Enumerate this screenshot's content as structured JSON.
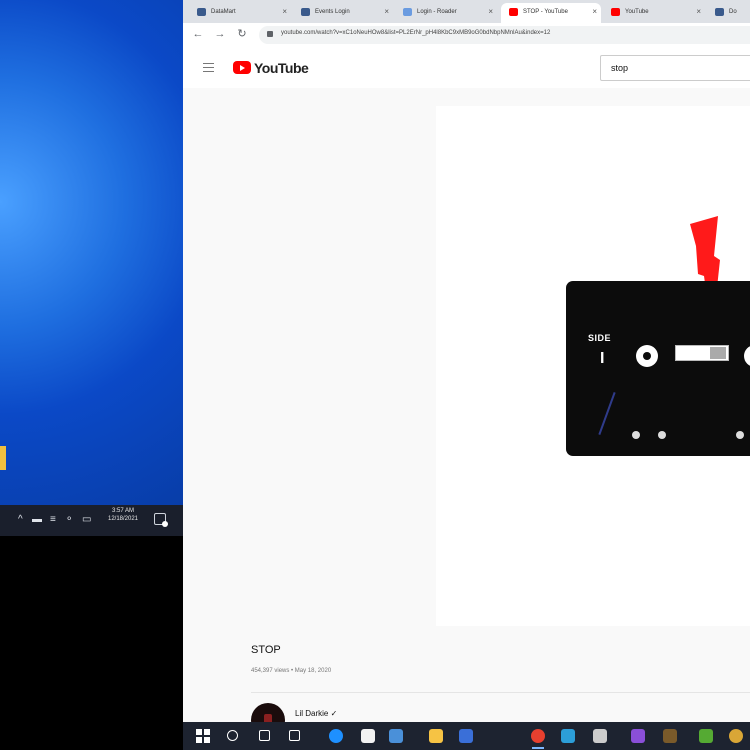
{
  "desktop": {
    "tray": {
      "glyphs": [
        "^",
        "▬",
        "≡",
        "⚬",
        "▭"
      ],
      "time": "3:57 AM",
      "date": "12/18/2021"
    }
  },
  "browser": {
    "tabs": [
      {
        "label": "DataMart",
        "icon": "doc-icon",
        "active": false
      },
      {
        "label": "Events Login",
        "icon": "doc-icon",
        "active": false
      },
      {
        "label": "Login - Roader",
        "icon": "chart-icon",
        "active": false
      },
      {
        "label": "STOP - YouTube",
        "icon": "youtube-icon",
        "active": true
      },
      {
        "label": "YouTube",
        "icon": "youtube-icon",
        "active": false
      },
      {
        "label": "Do",
        "icon": "doc-icon",
        "active": false
      }
    ],
    "nav": {
      "back": "←",
      "forward": "→",
      "reload": "↻"
    },
    "url": "youtube.com/watch?v=xC1oNeuHOw8&list=PL2ErNr_pH4l8KbC9xMB9oG0bdNbpNMnlAu&index=12"
  },
  "youtube": {
    "logo_text": "YouTube",
    "search_value": "stop",
    "video": {
      "art": {
        "side_label": "SIDE",
        "side_number": "I"
      },
      "title": "STOP",
      "views": "454,397 views • May 18, 2020"
    },
    "channel": {
      "name": "Lil Darkie ✓"
    }
  },
  "taskbar": {
    "icons": [
      {
        "name": "start-button-icon",
        "color": "#ffffff"
      },
      {
        "name": "search-icon",
        "color": "#ffffff"
      },
      {
        "name": "task-view-icon",
        "color": "#ffffff"
      },
      {
        "name": "widgets-icon",
        "color": "#ffffff"
      },
      {
        "name": "edge-icon",
        "color": "#1e90ff"
      },
      {
        "name": "store-icon",
        "color": "#f2f2f2"
      },
      {
        "name": "mail-icon",
        "color": "#4a90d9"
      },
      {
        "name": "file-explorer-icon",
        "color": "#f6c344"
      },
      {
        "name": "teams-icon",
        "color": "#3a6fd8"
      },
      {
        "name": "chrome-icon",
        "color": "#e7402f"
      },
      {
        "name": "app-icon",
        "color": "#2c9ed8"
      },
      {
        "name": "terminal-icon",
        "color": "#cccccc"
      },
      {
        "name": "media-icon",
        "color": "#8a4fd8"
      },
      {
        "name": "minecraft-icon",
        "color": "#7a5a2a"
      },
      {
        "name": "game-icon",
        "color": "#55aa33"
      },
      {
        "name": "photos-icon",
        "color": "#d9a636"
      }
    ]
  }
}
